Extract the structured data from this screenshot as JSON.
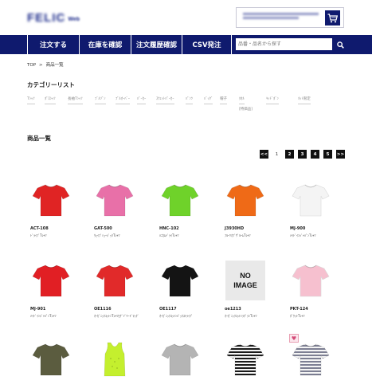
{
  "header": {
    "logo_main": "FELIC",
    "logo_sub": "Web"
  },
  "nav": {
    "items": [
      "注文する",
      "在庫を確認",
      "注文履歴確認",
      "CSV発注"
    ],
    "search_placeholder": "品番・品名から探す"
  },
  "breadcrumb": [
    "TOP",
    ">",
    "商品一覧"
  ],
  "categories": {
    "title": "カテゴリーリスト",
    "items": [
      "Tｼｬﾂ",
      "ﾎﾟﾛｼｬﾂ",
      "長袖Tｼｬﾂ",
      "ﾌﾞﾙｿﾞﾝ",
      "ﾌﾟﾙｵｰﾊﾞｰ",
      "ﾊﾟｰｶｰ",
      "ｽｳｪｯﾄﾊﾟｰｶｰ",
      "ﾊﾟﾝﾂ",
      "ﾊﾞｯｸﾞ",
      "帽子",
      "ﾀｵﾙ",
      "ｷｯﾄﾞﾎﾞﾝ",
      "ﾈｯﾄ限定"
    ],
    "sub": "[特価品]"
  },
  "products_title": "商品一覧",
  "pagination": {
    "prev": "<<",
    "pages": [
      "1",
      "2",
      "3",
      "4",
      "5"
    ],
    "current": "1",
    "next": ">>"
  },
  "products": [
    {
      "code": "ACT-108",
      "name": "ﾄﾞﾗｲﾌﾞTｼｬﾂ",
      "color": "#e02424"
    },
    {
      "code": "GAT-500",
      "name": "ｳｪｲﾌﾞﾐｭｰｼﾞｯｸTｼｬﾂ",
      "color": "#e870a8"
    },
    {
      "code": "HNC-102",
      "name": "ﾊﾆｶﾑﾄﾞﾗｲTｼｬﾂ",
      "color": "#6fd22a"
    },
    {
      "code": "J3930HD",
      "name": "ﾌﾙｰﾂｵﾌﾞｻﾞﾙｰﾑTｼｬﾂ",
      "color": "#ef6a17"
    },
    {
      "code": "MJ-900",
      "name": "ﾒｲﾄﾞｲﾝｼﾞｬﾊﾟﾝTｼｬﾂ",
      "color": "#f4f4f4"
    },
    {
      "code": "MJ-901",
      "name": "ﾒｲﾄﾞｲﾝｼﾞｬﾊﾟﾝTｼｬﾂ",
      "color": "#e11f24"
    },
    {
      "code": "OE1116",
      "name": "ｵｰｶﾞﾆｯｸｺｯﾄﾝTｼｬﾂﾋｹﾞｿﾞﾘｰﾄﾞﾏｯｸﾞ",
      "color": "#e12a2a"
    },
    {
      "code": "OE1117",
      "name": "ｵｰｶﾞﾆｯｸｺｯﾄﾝﾊﾞｯｸｽﾄﾗｲﾌﾟ",
      "color": "#141414"
    },
    {
      "code": "oe1213",
      "name": "ｵｰｶﾞﾆｯｸｺｯﾄﾝﾗｸﾞﾗﾝTｼｬﾂ",
      "color": "none",
      "noimage": [
        "NO",
        "IMAGE"
      ]
    },
    {
      "code": "PKT-124",
      "name": "ﾎﾟｹｯﾄTｼｬﾂ",
      "color": "#f6c0cf"
    },
    {
      "code": "",
      "name": "",
      "color": "#5b5c3f"
    },
    {
      "code": "",
      "name": "",
      "color": "#c4ef2e",
      "tank": true
    },
    {
      "code": "",
      "name": "",
      "color": "#b4b4b4"
    },
    {
      "code": "",
      "name": "",
      "color": "stripe-black"
    },
    {
      "code": "",
      "name": "",
      "color": "stripe-gray",
      "fav": "♥"
    }
  ]
}
